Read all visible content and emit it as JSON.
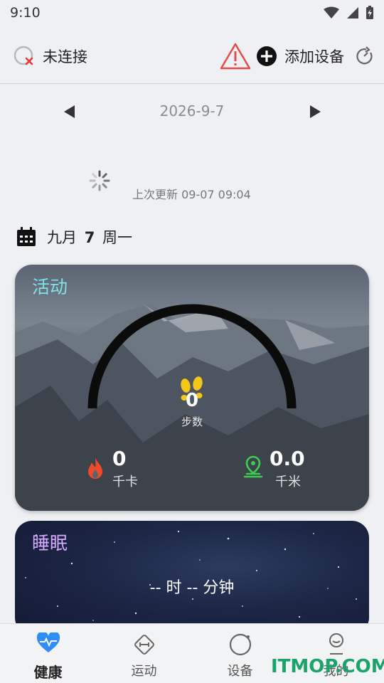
{
  "status_bar": {
    "time": "9:10"
  },
  "header": {
    "connection_status": "未连接",
    "add_device_label": "添加设备"
  },
  "date_nav": {
    "date": "2026-9-7"
  },
  "sync": {
    "last_update": "上次更新 09-07 09:04"
  },
  "date_row": {
    "month_day": "九月",
    "day": "7",
    "weekday": "周一"
  },
  "activity": {
    "title": "活动",
    "steps_value": "0",
    "steps_label": "步数",
    "calories_value": "0",
    "calories_unit": "千卡",
    "distance_value": "0.0",
    "distance_unit": "千米"
  },
  "sleep": {
    "title": "睡眠",
    "duration_text": "-- 时 -- 分钟"
  },
  "bottom_nav": {
    "items": [
      {
        "label": "健康",
        "icon": "heart-pulse-icon",
        "active": true
      },
      {
        "label": "运动",
        "icon": "sport-diamond-icon",
        "active": false
      },
      {
        "label": "设备",
        "icon": "device-circle-icon",
        "active": false
      },
      {
        "label": "我的",
        "icon": "profile-icon",
        "active": false
      }
    ]
  },
  "watermark": "ITMOP.COM",
  "colors": {
    "accent_blue": "#2f8df5",
    "activity_title": "#7fe3e6",
    "sleep_title": "#d7a9ff",
    "flame": "#f04a2a",
    "location": "#3ccf4e",
    "warning": "#e54b4b"
  }
}
